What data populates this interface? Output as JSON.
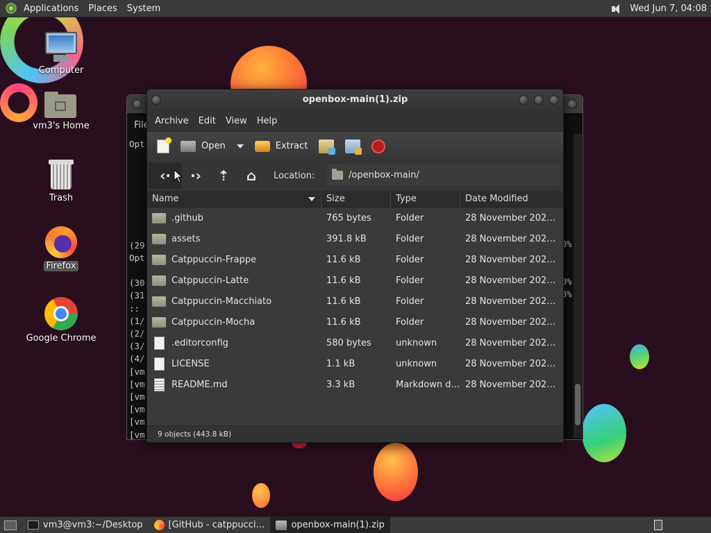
{
  "top_panel": {
    "menus": [
      "Applications",
      "Places",
      "System"
    ],
    "clock": "Wed Jun 7, 04:08"
  },
  "desktop_icons": [
    {
      "label": "Computer",
      "icon": "computer-icon"
    },
    {
      "label": "vm3's Home",
      "icon": "home-folder-icon"
    },
    {
      "label": "Trash",
      "icon": "trash-icon"
    },
    {
      "label": "Firefox",
      "icon": "firefox-icon"
    },
    {
      "label": "Google Chrome",
      "icon": "chrome-icon"
    }
  ],
  "terminal": {
    "menu_label": "File",
    "lines": [
      "Opt",
      "",
      "",
      "",
      "",
      "",
      "",
      "",
      "(29",
      "Opt",
      "",
      "(30",
      "(31",
      ":: ",
      "(1/",
      "(2/",
      "(3/",
      "(4/",
      "[vm",
      "[vm",
      "[vm",
      "[vm",
      "[vm",
      "[vm"
    ],
    "pct_1": "0%",
    "pct_2": "0%",
    "pct_3": "0%"
  },
  "window": {
    "title": "openbox-main(1).zip",
    "menus": [
      "Archive",
      "Edit",
      "View",
      "Help"
    ],
    "toolbar": {
      "open_label": "Open",
      "extract_label": "Extract"
    },
    "location": {
      "label": "Location:",
      "path": "/openbox-main/"
    },
    "columns": [
      "Name",
      "Size",
      "Type",
      "Date Modified"
    ],
    "files": [
      {
        "name": ".github",
        "size": "765 bytes",
        "type": "Folder",
        "date": "28 November 2022, …",
        "kind": "folder"
      },
      {
        "name": "assets",
        "size": "391.8 kB",
        "type": "Folder",
        "date": "28 November 2022, …",
        "kind": "folder"
      },
      {
        "name": "Catppuccin-Frappe",
        "size": "11.6 kB",
        "type": "Folder",
        "date": "28 November 2022, …",
        "kind": "folder"
      },
      {
        "name": "Catppuccin-Latte",
        "size": "11.6 kB",
        "type": "Folder",
        "date": "28 November 2022, …",
        "kind": "folder"
      },
      {
        "name": "Catppuccin-Macchiato",
        "size": "11.6 kB",
        "type": "Folder",
        "date": "28 November 2022, …",
        "kind": "folder"
      },
      {
        "name": "Catppuccin-Mocha",
        "size": "11.6 kB",
        "type": "Folder",
        "date": "28 November 2022, …",
        "kind": "folder"
      },
      {
        "name": ".editorconfig",
        "size": "580 bytes",
        "type": "unknown",
        "date": "28 November 2022, …",
        "kind": "file"
      },
      {
        "name": "LICENSE",
        "size": "1.1 kB",
        "type": "unknown",
        "date": "28 November 2022, …",
        "kind": "file"
      },
      {
        "name": "README.md",
        "size": "3.3 kB",
        "type": "Markdown d…",
        "date": "28 November 2022, …",
        "kind": "markdown"
      }
    ],
    "status": "9 objects (443.8 kB)"
  },
  "taskbar": {
    "tasks": [
      {
        "label": "vm3@vm3:~/Desktop",
        "icon": "terminal-icon"
      },
      {
        "label": "[GitHub - catppucci…",
        "icon": "firefox-icon"
      },
      {
        "label": "openbox-main(1).zip",
        "icon": "archive-icon"
      }
    ]
  }
}
